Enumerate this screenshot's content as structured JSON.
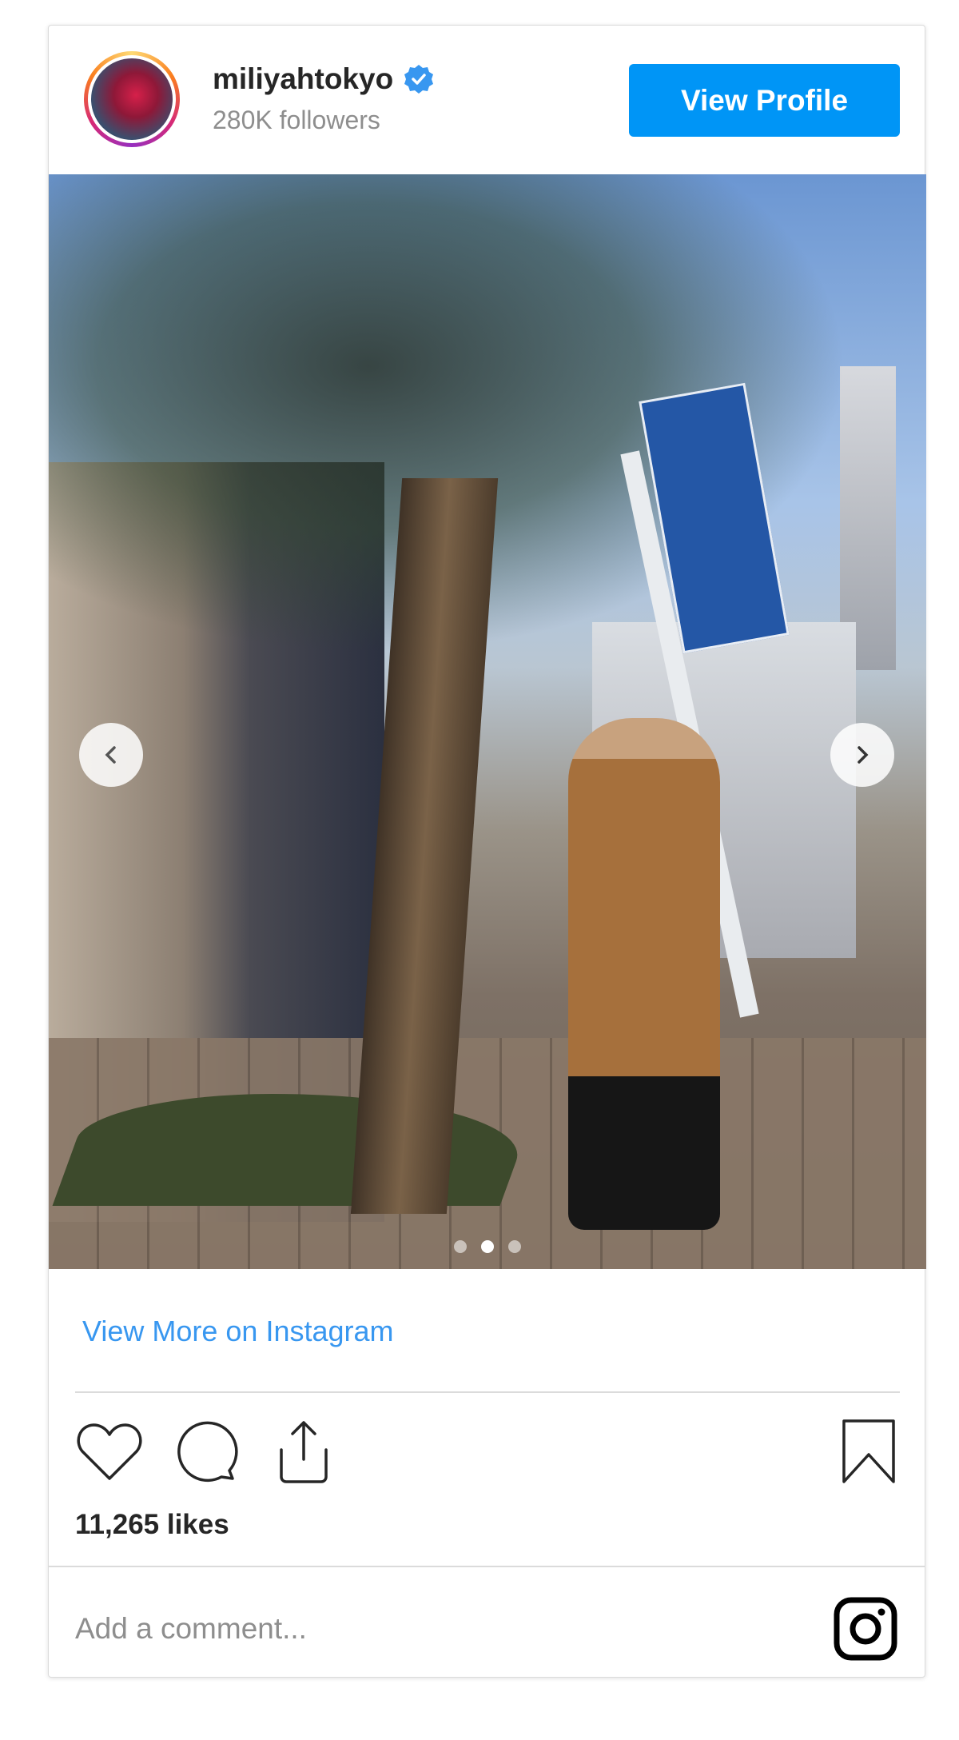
{
  "header": {
    "username": "miliyahtokyo",
    "verified": true,
    "followers": "280K followers",
    "view_profile_label": "View Profile"
  },
  "carousel": {
    "total_slides": 3,
    "active_slide": 2,
    "prev_icon": "chevron-left-icon",
    "next_icon": "chevron-right-icon"
  },
  "view_more_label": "View More on Instagram",
  "actions": {
    "icons": [
      "heart-icon",
      "comment-icon",
      "share-icon",
      "bookmark-icon"
    ]
  },
  "likes": "11,265 likes",
  "comment": {
    "placeholder": "Add a comment...",
    "value": ""
  },
  "colors": {
    "accent": "#0095f6",
    "link": "#3897f0",
    "text": "#262626",
    "muted": "#8e8e8e"
  }
}
